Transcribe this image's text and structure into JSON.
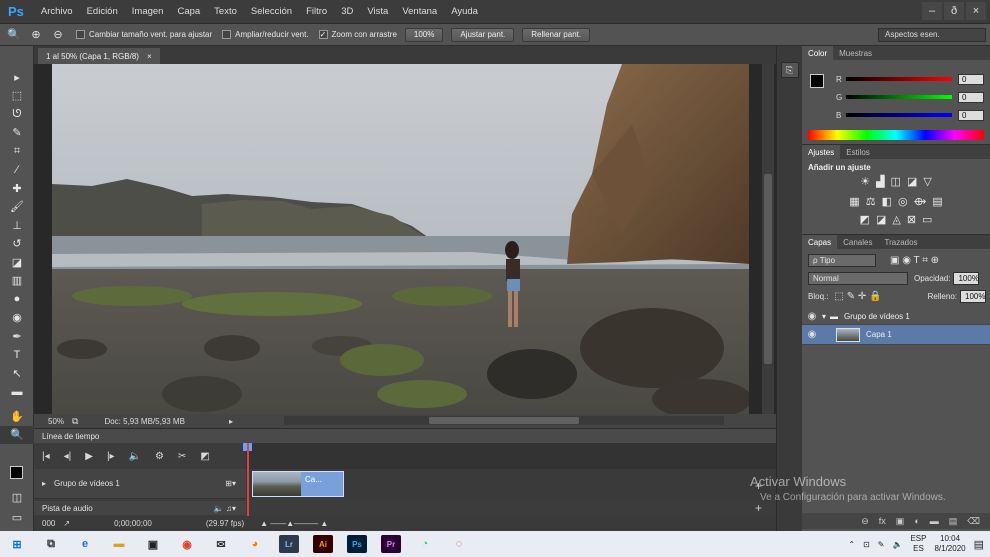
{
  "app": {
    "logo": "Ps"
  },
  "menu": [
    "Archivo",
    "Edición",
    "Imagen",
    "Capa",
    "Texto",
    "Selección",
    "Filtro",
    "3D",
    "Vista",
    "Ventana",
    "Ayuda"
  ],
  "window_controls": {
    "minimize": "–",
    "restore": "ð",
    "close": "×"
  },
  "options": {
    "fit_window": "Cambiar tamaño vent. para ajustar",
    "zoom_all": "Ampliar/reducir vent.",
    "scrubby_zoom": "Zoom con arrastre",
    "zoom_100": "100%",
    "fit_screen": "Ajustar pant.",
    "fill_screen": "Rellenar pant.",
    "workspace": "Aspectos esen."
  },
  "document": {
    "tab_title": "1 al 50% (Capa 1, RGB/8)",
    "tab_close": "×",
    "zoom": "50%",
    "doc_info": "Doc: 5,93 MB/5,93 MB"
  },
  "timeline": {
    "title": "Línea de tiempo",
    "track_video": "Grupo de vídeos 1",
    "clip_label": "Ca...",
    "track_audio": "Pista de audio",
    "timecode": "0;00;00;00",
    "fps": "(29.97 fps)",
    "frame": "000"
  },
  "color_panel": {
    "tabs": [
      "Color",
      "Muestras"
    ],
    "r_label": "R",
    "g_label": "G",
    "b_label": "B",
    "r": "0",
    "g": "0",
    "b": "0"
  },
  "adjust_panel": {
    "tabs": [
      "Ajustes",
      "Estilos"
    ],
    "title": "Añadir un ajuste"
  },
  "layers_panel": {
    "tabs": [
      "Capas",
      "Canales",
      "Trazados"
    ],
    "filter": "ρ Tipo",
    "blend_mode": "Normal",
    "opacity_label": "Opacidad:",
    "opacity": "100%",
    "lock_label": "Bloq.:",
    "fill_label": "Relleno:",
    "fill": "100%",
    "layers": [
      {
        "name": "Grupo de vídeos 1"
      },
      {
        "name": "Capa 1"
      }
    ]
  },
  "watermark": {
    "title": "Activar Windows",
    "subtitle": "Ve a Configuración para activar Windows."
  },
  "taskbar": {
    "lang": "ESP",
    "region": "ES",
    "time": "10:04",
    "date": "8/1/2020"
  }
}
